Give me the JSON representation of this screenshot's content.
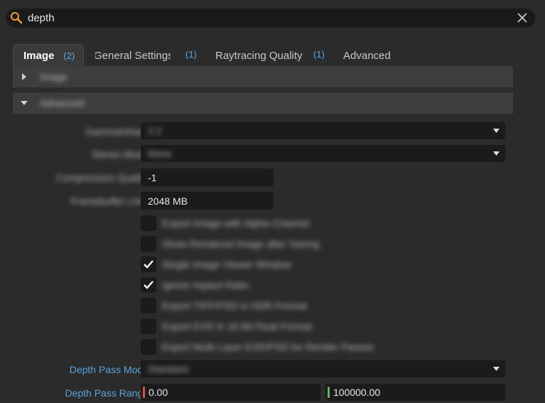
{
  "search": {
    "value": "depth",
    "icon": "search-icon",
    "accent": "#f0a030"
  },
  "tabs": [
    {
      "label": "Image",
      "badge": "(2)",
      "active": true
    },
    {
      "label": "General Settings",
      "badge": "(1)",
      "active": false
    },
    {
      "label": "Raytracing Quality",
      "badge": "(1)",
      "active": false
    },
    {
      "label": "Advanced",
      "badge": "",
      "active": false
    }
  ],
  "sections": {
    "image": {
      "title": "Image",
      "expanded": false
    },
    "advanced": {
      "title": "Advanced",
      "expanded": true
    }
  },
  "fields": {
    "gamma_label": "Gamma/sharp",
    "gamma_value": "2.2",
    "stereo_label": "Stereo Mode",
    "stereo_value": "None",
    "compression_label": "Compression Quality",
    "compression_value": "-1",
    "framebuffer_label": "Framebuffer Limit",
    "framebuffer_value": "2048 MB"
  },
  "checkboxes": [
    {
      "label": "Export Image with Alpha Channel",
      "checked": false
    },
    {
      "label": "Show Rendered Image after Saving",
      "checked": false
    },
    {
      "label": "Single Image Viewer Window",
      "checked": true
    },
    {
      "label": "Ignore Aspect Ratio",
      "checked": true
    },
    {
      "label": "Export TIFF/PSD in HDR Format",
      "checked": false
    },
    {
      "label": "Export EXR in 16 Bit Float Format",
      "checked": false
    },
    {
      "label": "Export Multi Layer EXR/PSD for Render Passes",
      "checked": false
    }
  ],
  "depth_pass": {
    "mode_label": "Depth Pass Mode",
    "mode_value": "Standard",
    "range_label": "Depth Pass Range",
    "range_min": "0.00",
    "range_max": "100000.00",
    "min_color": "#d9534f",
    "max_color": "#5cb85c"
  }
}
